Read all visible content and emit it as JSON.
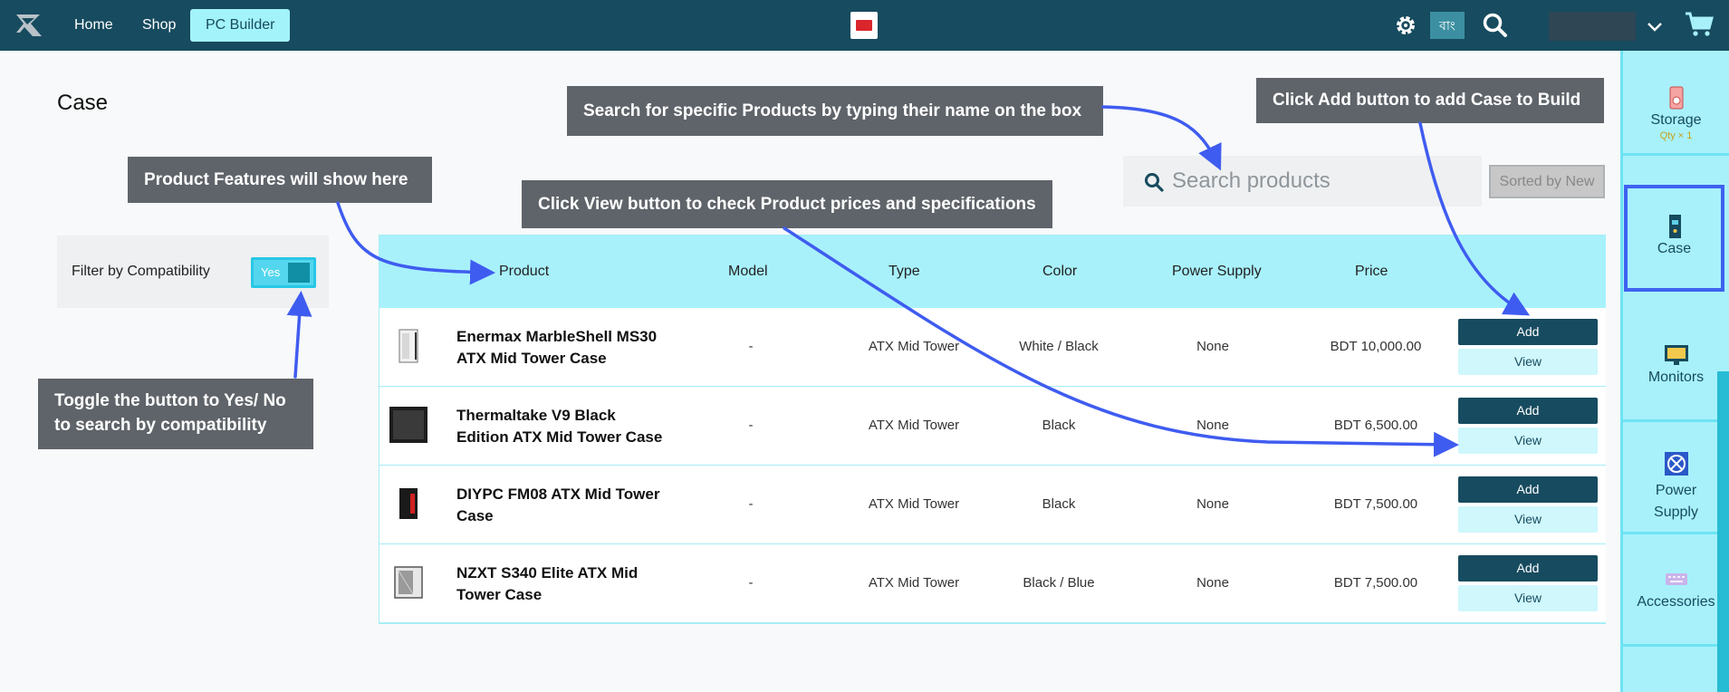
{
  "nav": {
    "items": [
      {
        "label": "Home"
      },
      {
        "label": "Shop"
      },
      {
        "label": "PC Builder"
      }
    ],
    "lang_label": "বাং"
  },
  "page": {
    "title": "Case"
  },
  "filter": {
    "label": "Filter by Compatibility",
    "toggle_label": "Yes"
  },
  "search": {
    "placeholder": "Search products",
    "value": ""
  },
  "sort": {
    "label": "Sorted by New"
  },
  "table": {
    "headers": [
      "Product",
      "Model",
      "Type",
      "Color",
      "Power Supply",
      "Price"
    ],
    "rows": [
      {
        "name": "Enermax MarbleShell MS30 ATX Mid Tower Case",
        "model": "-",
        "type": "ATX Mid Tower",
        "color": "White / Black",
        "power_supply": "None",
        "price": "BDT 10,000.00"
      },
      {
        "name": "Thermaltake V9 Black Edition ATX Mid Tower Case",
        "model": "-",
        "type": "ATX Mid Tower",
        "color": "Black",
        "power_supply": "None",
        "price": "BDT 6,500.00"
      },
      {
        "name": "DIYPC FM08 ATX Mid Tower Case",
        "model": "-",
        "type": "ATX Mid Tower",
        "color": "Black",
        "power_supply": "None",
        "price": "BDT 7,500.00"
      },
      {
        "name": "NZXT S340 Elite ATX Mid Tower Case",
        "model": "-",
        "type": "ATX Mid Tower",
        "color": "Black / Blue",
        "power_supply": "None",
        "price": "BDT 7,500.00"
      }
    ],
    "add_label": "Add",
    "view_label": "View"
  },
  "sidebar": {
    "items": [
      {
        "label": "Storage",
        "qty": "Qty × 1",
        "icon": "storage-icon"
      },
      {
        "label": "Case",
        "icon": "case-icon"
      },
      {
        "label": "Monitors",
        "icon": "monitor-icon"
      },
      {
        "label": "Power Supply",
        "icon": "power-supply-icon"
      },
      {
        "label": "Accessories",
        "icon": "accessories-icon"
      }
    ]
  },
  "callouts": {
    "features": "Product Features will show here",
    "search": "Search for specific Products by typing their name on the box",
    "add": "Click Add button to add Case to Build",
    "view": "Click View button to check Product prices and specifications",
    "toggle_line1": "Toggle the button to Yes/ No",
    "toggle_line2": "to search by compatibility"
  },
  "colors": {
    "nav_bg": "#174b5f",
    "accent": "#a8f1fb",
    "highlight_border": "#3f62f0",
    "callout_bg": "#5f646a"
  }
}
